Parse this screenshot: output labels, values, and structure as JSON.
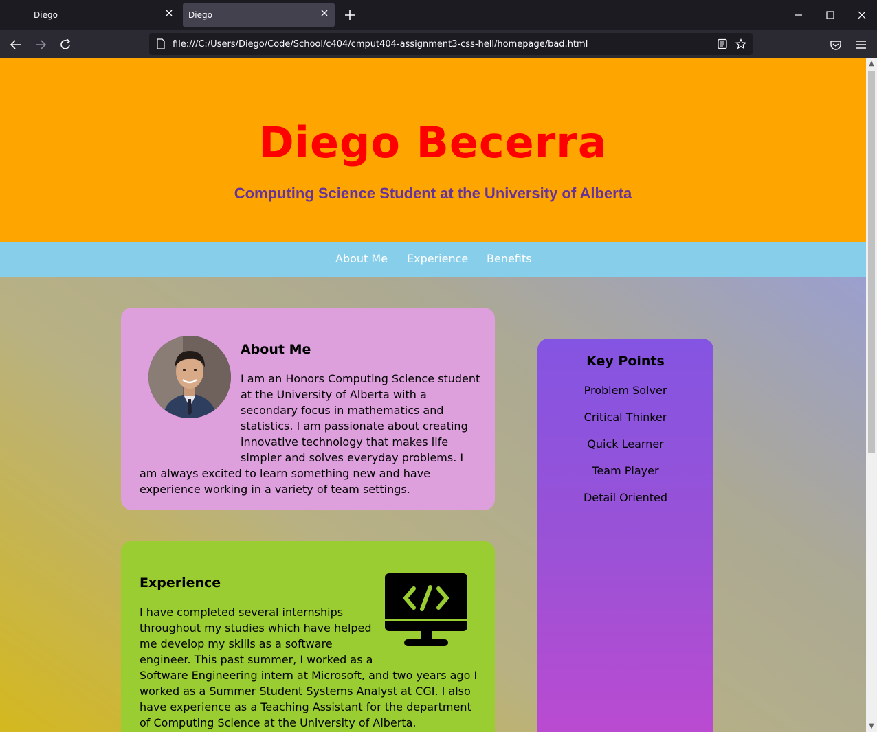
{
  "browser": {
    "tabs": [
      {
        "title": "Diego",
        "active": false
      },
      {
        "title": "Diego",
        "active": true
      }
    ],
    "url": "file:///C:/Users/Diego/Code/School/c404/cmput404-assignment3-css-hell/homepage/bad.html"
  },
  "header": {
    "name": "Diego Becerra",
    "subtitle": "Computing Science Student at the University of Alberta"
  },
  "nav": {
    "items": [
      "About Me",
      "Experience",
      "Benefits"
    ]
  },
  "about": {
    "title": "About Me",
    "text": "I am an Honors Computing Science student at the University of Alberta with a secondary focus in mathematics and statistics. I am passionate about creating innovative technology that makes life simpler and solves everyday problems. I am always excited to learn something new and have experience working in a variety of team settings."
  },
  "experience": {
    "title": "Experience",
    "text": "I have completed several internships throughout my studies which have helped me develop my skills as a software engineer. This past summer, I worked as a Software Engineering intern at Microsoft, and two years ago I worked as a Summer Student Systems Analyst at CGI. I also have experience as a Teaching Assistant for the department of Computing Science at the University of Alberta."
  },
  "key_points": {
    "title": "Key Points",
    "items": [
      "Problem Solver",
      "Critical Thinker",
      "Quick Learner",
      "Team Player",
      "Detail Oriented"
    ]
  },
  "colors": {
    "header_bg": "#ffa500",
    "name": "#ff0000",
    "subtitle": "#663399",
    "nav_bg": "#87ceeb",
    "about_bg": "#dda0dd",
    "experience_bg": "#9acd32"
  },
  "icons": [
    "computer-code-icon",
    "avatar-photo"
  ]
}
